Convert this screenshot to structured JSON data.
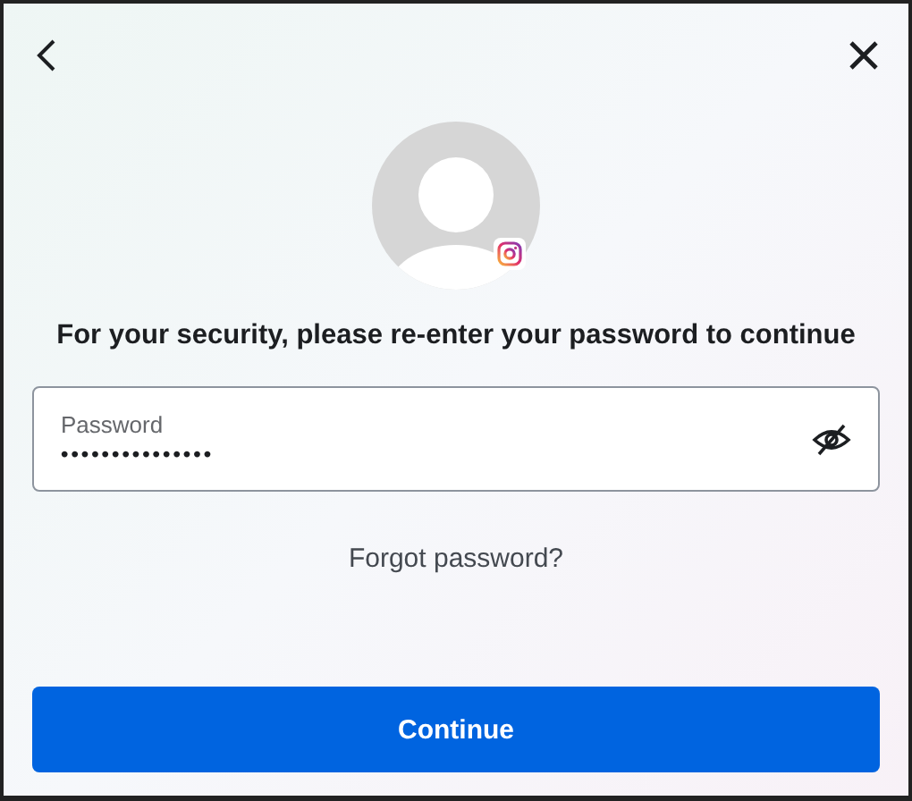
{
  "dialog": {
    "heading": "For your security, please re-enter your password to continue"
  },
  "password_field": {
    "label": "Password",
    "value": "•••••••••••••••"
  },
  "forgot_link": "Forgot password?",
  "primary_button": "Continue"
}
